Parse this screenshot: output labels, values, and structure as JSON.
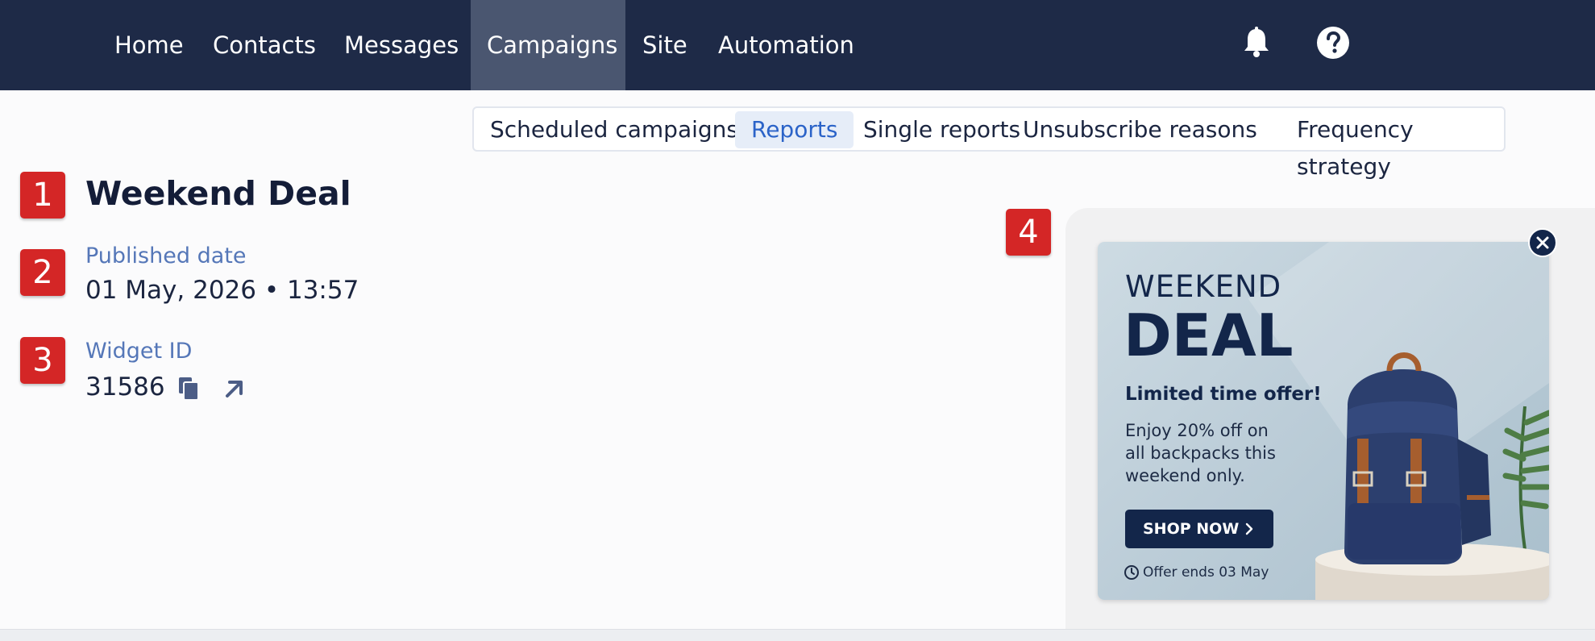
{
  "nav": {
    "items": [
      {
        "label": "Home"
      },
      {
        "label": "Contacts"
      },
      {
        "label": "Messages"
      },
      {
        "label": "Campaigns",
        "active": true
      },
      {
        "label": "Site"
      },
      {
        "label": "Automation"
      }
    ],
    "icons": [
      "bell-icon",
      "help-icon"
    ]
  },
  "subnav": {
    "tabs": [
      {
        "label": "Scheduled campaigns"
      },
      {
        "label": "Reports",
        "active": true
      },
      {
        "label": "Single reports"
      },
      {
        "label": "Unsubscribe reasons"
      },
      {
        "label": "Frequency strategy"
      }
    ]
  },
  "markers": [
    "1",
    "2",
    "3",
    "4"
  ],
  "detail": {
    "title": "Weekend Deal",
    "published_label": "Published date",
    "published_value": "01 May, 2026 • 13:57",
    "widget_label": "Widget ID",
    "widget_value": "31586"
  },
  "banner": {
    "line1": "WEEKEND",
    "line2": "DEAL",
    "limited": "Limited time offer!",
    "body": "Enjoy 20% off on all backpacks this weekend only.",
    "cta": "SHOP NOW",
    "ends": "Offer ends 03 May"
  },
  "colors": {
    "nav_bg": "#1e2a47",
    "marker": "#d42626",
    "link_label": "#5577b8",
    "accent_tab": "#2b63c8",
    "banner_dark": "#13264a"
  }
}
